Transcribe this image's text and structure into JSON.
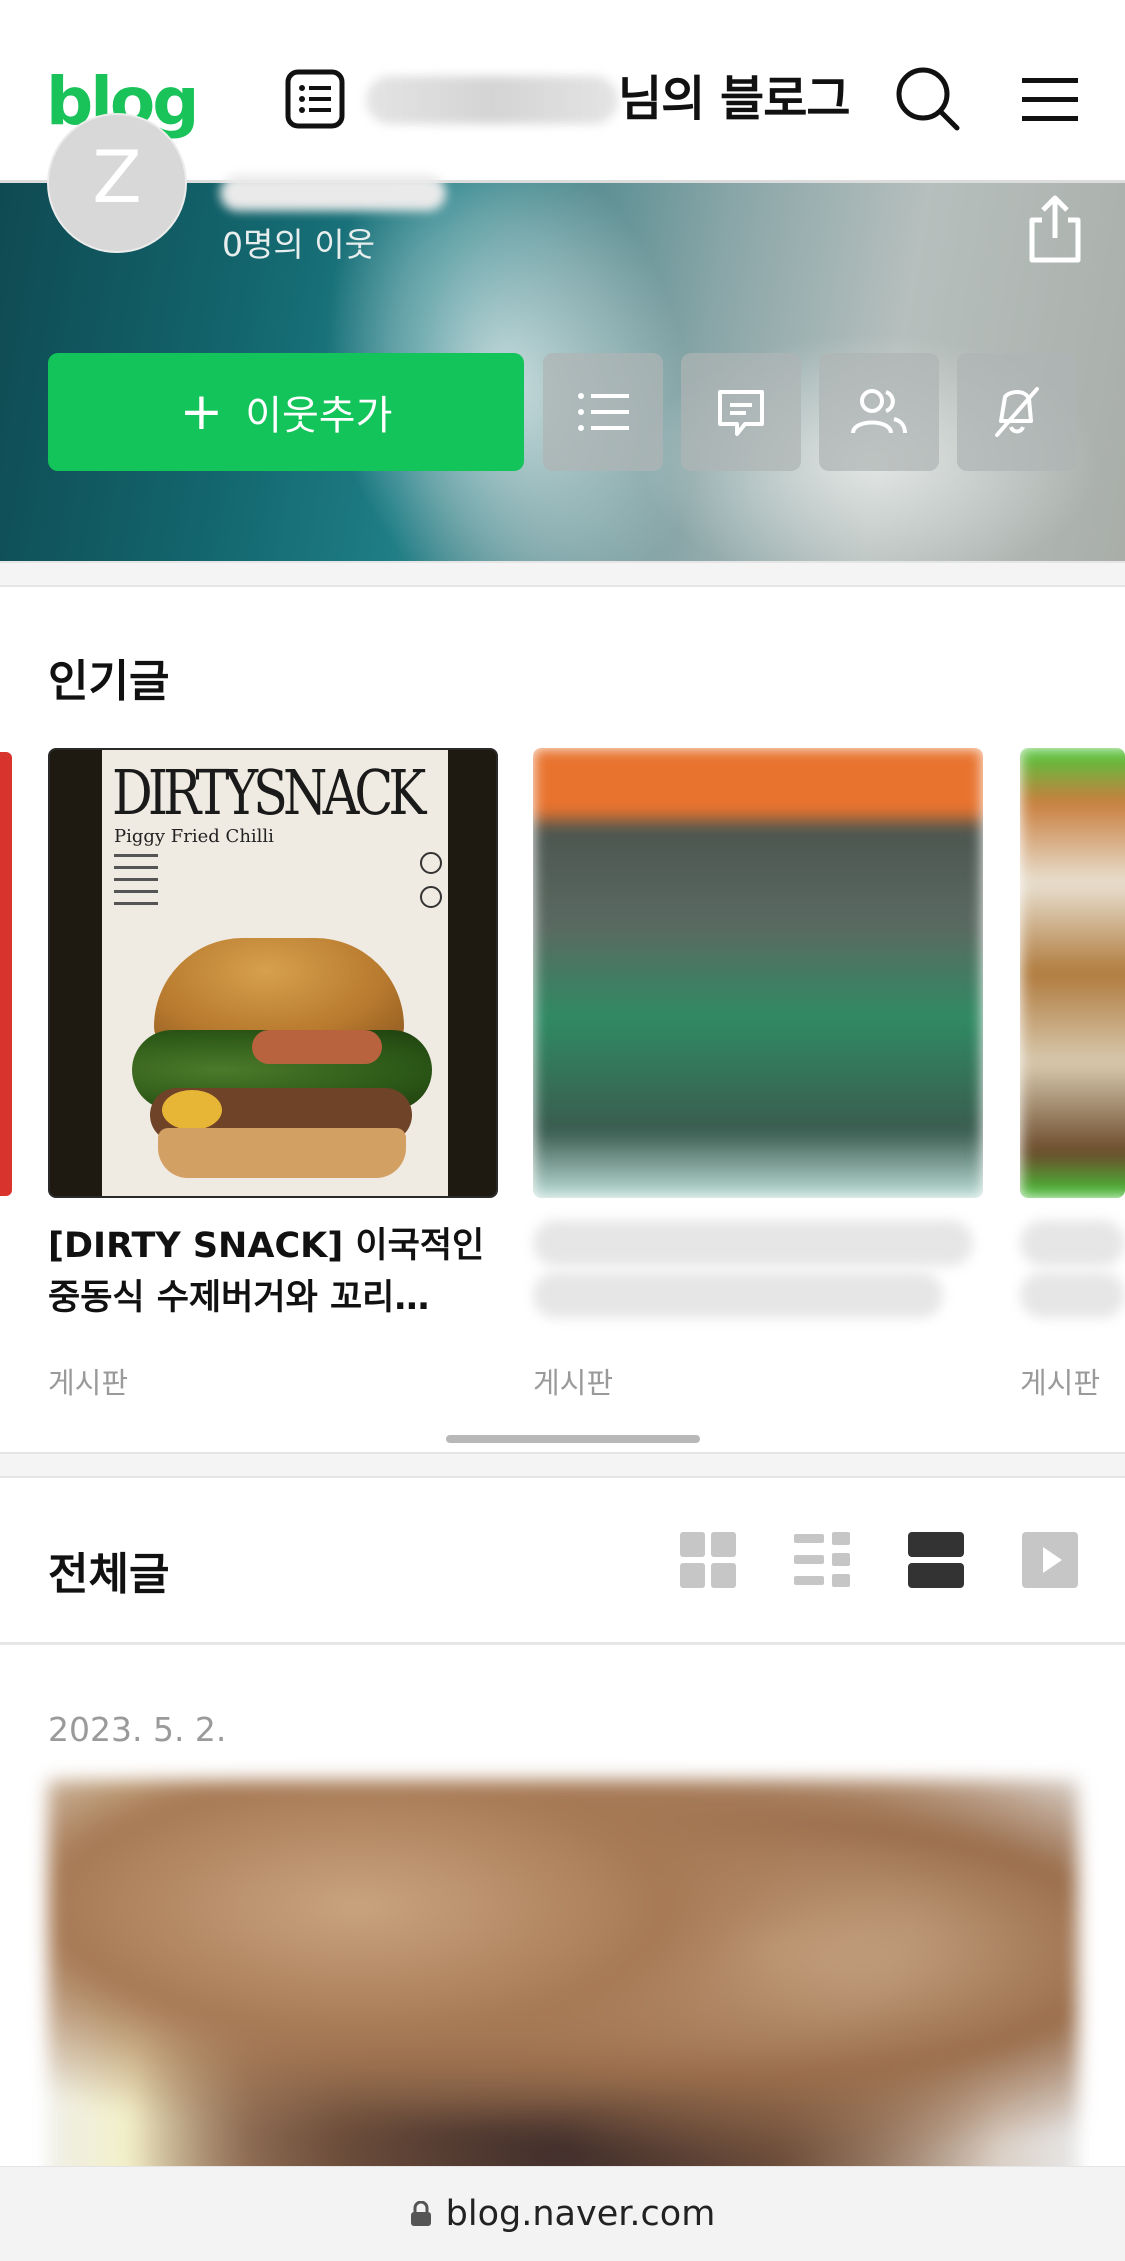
{
  "header": {
    "logo": "blog",
    "title": "님의 블로그"
  },
  "profile": {
    "avatar_letter": "Z",
    "neighbors": "0명의 이웃",
    "add_neighbor": "이웃추가"
  },
  "popular": {
    "title": "인기글",
    "cards": [
      {
        "poster_title": "DIRTYSNACK",
        "poster_subtitle": "Piggy Fried Chilli",
        "title": "[DIRTY SNACK] 이국적인 중동식 수제버거와 꼬리…",
        "board": "게시판"
      },
      {
        "board": "게시판"
      },
      {
        "board": "게시판"
      }
    ]
  },
  "all_posts": {
    "title": "전체글",
    "date": "2023. 5. 2."
  },
  "urlbar": {
    "url": "blog.naver.com"
  },
  "colors": {
    "brand_green": "#19c35a",
    "button_green": "#13c45a"
  },
  "icons": [
    "list-icon",
    "search-icon",
    "menu-icon",
    "share-icon",
    "plus-icon",
    "category-icon",
    "comment-icon",
    "neighbors-icon",
    "notify-off-icon",
    "grid-view-icon",
    "list-thumb-view-icon",
    "card-view-icon",
    "video-view-icon",
    "lock-icon"
  ]
}
